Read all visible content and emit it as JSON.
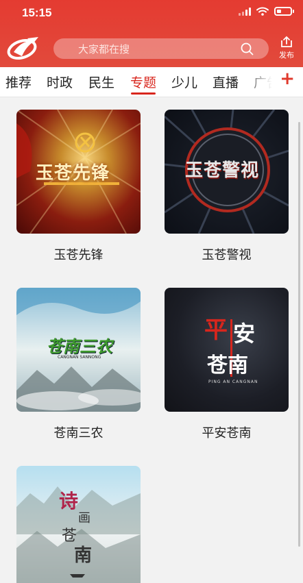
{
  "status_bar": {
    "time": "15:15"
  },
  "header": {
    "search_placeholder": "大家都在搜",
    "publish_label": "发布",
    "colors": {
      "brand_red": "#e43b31",
      "tab_active": "#d8261d"
    }
  },
  "tabs": [
    {
      "label": "推荐",
      "active": false
    },
    {
      "label": "时政",
      "active": false
    },
    {
      "label": "民生",
      "active": false
    },
    {
      "label": "专题",
      "active": true
    },
    {
      "label": "少儿",
      "active": false
    },
    {
      "label": "直播",
      "active": false
    },
    {
      "label": "广告",
      "active": false
    }
  ],
  "add_tab_icon": "plus-icon",
  "programs": [
    {
      "title": "玉苍先锋",
      "thumb_text": "玉苍先锋"
    },
    {
      "title": "玉苍警视",
      "thumb_text": "玉苍警视"
    },
    {
      "title": "苍南三农",
      "thumb_text": "苍南三农",
      "thumb_subtext": "CANGNAN SANNONG"
    },
    {
      "title": "平安苍南",
      "thumb_text_1": "平",
      "thumb_text_2": "安",
      "thumb_text_3": "苍南",
      "thumb_subtext": "PING AN CANGNAN"
    },
    {
      "title": "",
      "thumb_text_1": "诗",
      "thumb_text_2": "画",
      "thumb_text_3": "苍",
      "thumb_text_4": "南"
    }
  ]
}
